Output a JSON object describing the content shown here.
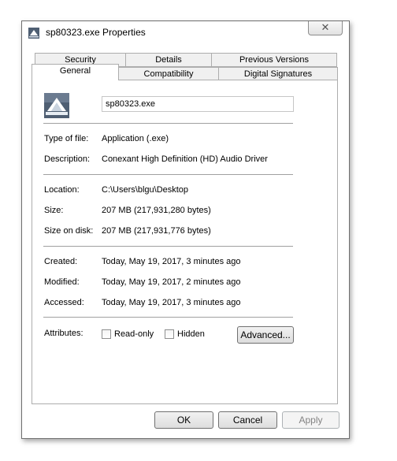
{
  "window": {
    "title": "sp80323.exe Properties",
    "close_glyph": "✕"
  },
  "tabs": {
    "row1": [
      "Security",
      "Details",
      "Previous Versions"
    ],
    "row2": [
      "General",
      "Compatibility",
      "Digital Signatures"
    ],
    "active": "General"
  },
  "general": {
    "file_name": "sp80323.exe",
    "type_label": "Type of file:",
    "type_value": "Application (.exe)",
    "desc_label": "Description:",
    "desc_value": "Conexant High Definition (HD) Audio Driver",
    "location_label": "Location:",
    "location_value": "C:\\Users\\blgu\\Desktop",
    "size_label": "Size:",
    "size_value": "207 MB (217,931,280 bytes)",
    "sizeondisk_label": "Size on disk:",
    "sizeondisk_value": "207 MB (217,931,776 bytes)",
    "created_label": "Created:",
    "created_value": "Today, May 19, 2017, 3 minutes ago",
    "modified_label": "Modified:",
    "modified_value": "Today, May 19, 2017, 2 minutes ago",
    "accessed_label": "Accessed:",
    "accessed_value": "Today, May 19, 2017, 3 minutes ago",
    "attributes_label": "Attributes:",
    "readonly_label": "Read-only",
    "readonly_checked": false,
    "hidden_label": "Hidden",
    "hidden_checked": false,
    "advanced_label": "Advanced..."
  },
  "buttons": {
    "ok": "OK",
    "cancel": "Cancel",
    "apply": "Apply",
    "apply_enabled": false
  },
  "icons": {
    "title": "installer-app-icon",
    "file": "installer-app-icon"
  }
}
